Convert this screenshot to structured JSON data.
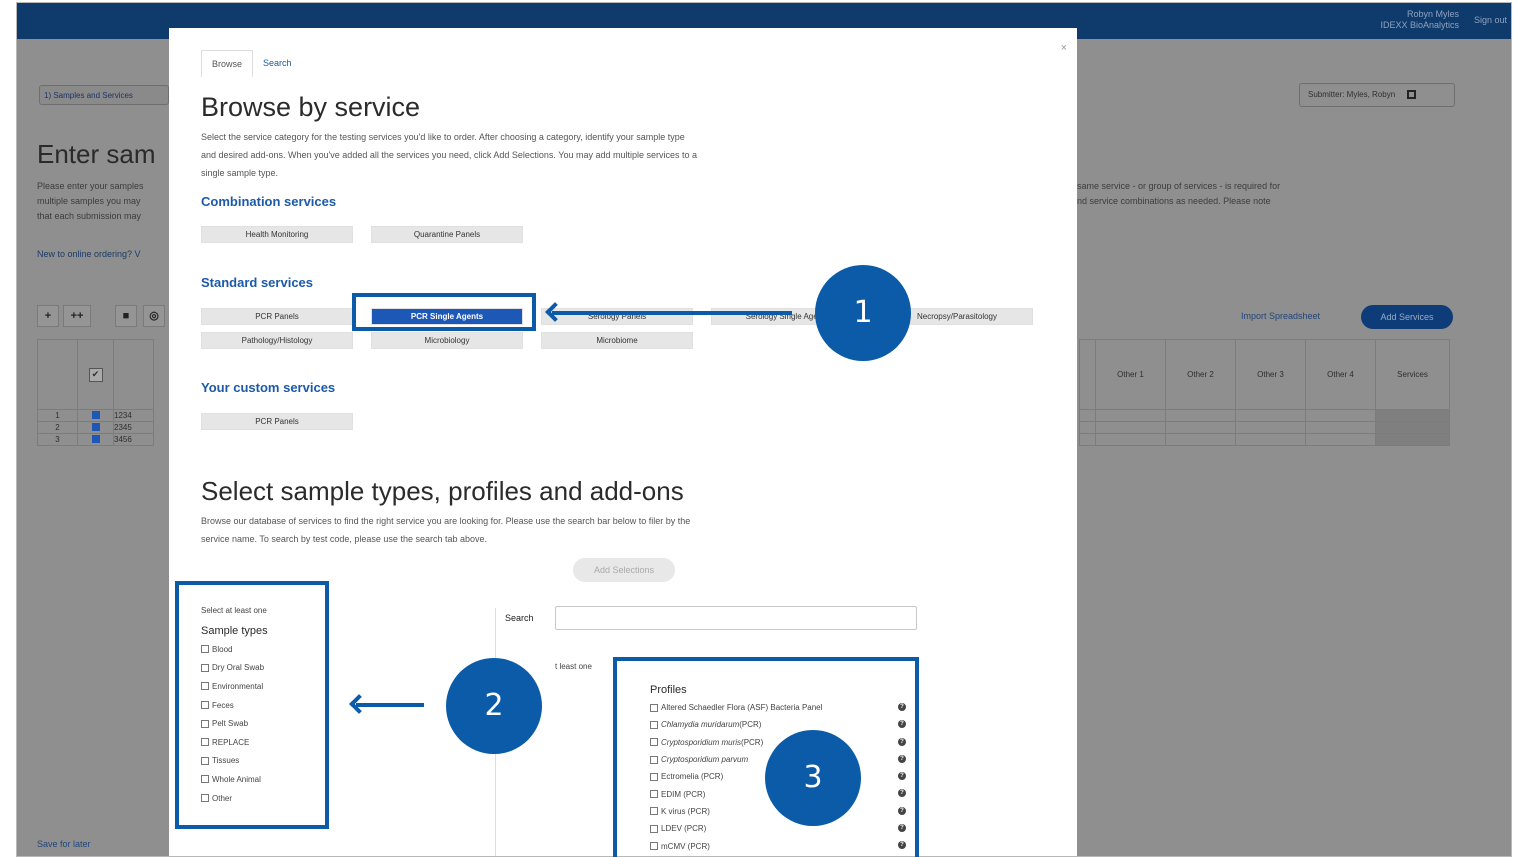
{
  "app": {
    "user_name": "Robyn Myles",
    "org": "IDEXX BioAnalytics",
    "signout": "Sign out",
    "step": "1) Samples and Services",
    "submitter": "Submitter: Myles, Robyn",
    "page_title": "Enter sam",
    "intro_line1": "Please enter your samples",
    "intro_line2": "multiple samples you may",
    "intro_line3": "that each submission may",
    "intro_right1": "same service - or group of services - is required for",
    "intro_right2": "nd service combinations as needed. Please note",
    "new_link": "New to online ordering? V",
    "import_link": "Import Spreadsheet",
    "add_services": "Add Services",
    "columns": [
      "Other 1",
      "Other 2",
      "Other 3",
      "Other 4",
      "Services"
    ],
    "rows": [
      {
        "num": "1",
        "id": "1234"
      },
      {
        "num": "2",
        "id": "2345"
      },
      {
        "num": "3",
        "id": "3456"
      }
    ],
    "save_later": "Save for later"
  },
  "modal": {
    "close": "×",
    "tabs": [
      "Browse",
      "Search"
    ],
    "title": "Browse by service",
    "intro_line1": "Select the service category for the testing services you'd like to order. After choosing a category, identify your sample type",
    "intro_line2": "and desired add-ons. When you've added all the services you need, click Add Selections. You may add multiple services to a",
    "intro_line3": "single sample type.",
    "combination_heading": "Combination services",
    "combination": [
      "Health Monitoring",
      "Quarantine Panels"
    ],
    "standard_heading": "Standard services",
    "standard_row1": [
      "PCR Panels",
      "PCR Single Agents",
      "Serology Panels",
      "Serology Single Agents",
      "Necropsy/Parasitology"
    ],
    "standard_row2": [
      "Pathology/Histology",
      "Microbiology",
      "Microbiome"
    ],
    "custom_heading": "Your custom services",
    "custom": [
      "PCR Panels"
    ],
    "select_title": "Select sample types, profiles and add-ons",
    "select_line1": "Browse our database of services to find the right service you are looking for. Please use the search bar below to filer by the",
    "select_line2": "service name. To search by test code, please use the search tab above.",
    "add_selections": "Add Selections",
    "select_at_least_one": "Select at least one",
    "sample_types_heading": "Sample types",
    "sample_types": [
      "Blood",
      "Dry Oral Swab",
      "Environmental",
      "Feces",
      "Pelt Swab",
      "REPLACE",
      "Tissues",
      "Whole Animal",
      "Other"
    ],
    "search_label": "Search",
    "search_value": "",
    "select_at_least_one_2": "t least one",
    "profiles_heading": "Profiles",
    "profiles": [
      {
        "label": "Altered Schaedler Flora (ASF) Bacteria Panel",
        "italic": ""
      },
      {
        "label": " (PCR)",
        "italic": "Chlamydia muridarum"
      },
      {
        "label": " (PCR)",
        "italic": "Cryptosporidium muris"
      },
      {
        "label": "",
        "italic": "Cryptosporidium parvum"
      },
      {
        "label": "Ectromelia (PCR)",
        "italic": ""
      },
      {
        "label": "EDIM (PCR)",
        "italic": ""
      },
      {
        "label": "K virus (PCR)",
        "italic": ""
      },
      {
        "label": "LDEV (PCR)",
        "italic": ""
      },
      {
        "label": "mCMV (PCR)",
        "italic": ""
      }
    ]
  },
  "callouts": [
    "1",
    "2",
    "3"
  ],
  "colors": {
    "accent": "#0b5ba8",
    "selected": "#1d58b6",
    "link": "#1c5aa8",
    "topbar": "#0e3a6c"
  }
}
